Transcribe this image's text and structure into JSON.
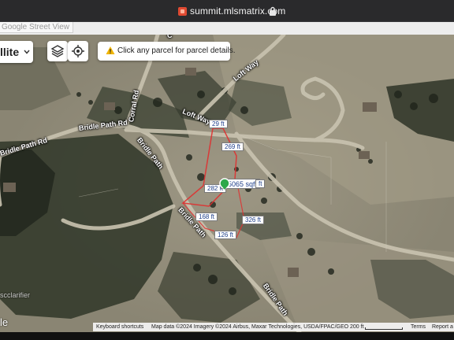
{
  "browser": {
    "url": "summit.mlsmatrix.com",
    "tab_label": "Google Street View"
  },
  "controls": {
    "map_type_label": "llite",
    "layers_icon": "layers-icon",
    "locate_icon": "locate-icon"
  },
  "hint": {
    "text": "Click any parcel for parcel details.",
    "icon": "warning-icon"
  },
  "roads": {
    "bridle_path_rd_1": "Bridle Path Rd",
    "bridle_path_rd_2": "Bridle Path Rd",
    "corral_rd": "Corral Rd",
    "loft_way_1": "Loft Way",
    "loft_way_2": "Loft Way",
    "bridle_path_1": "Bridle Path",
    "bridle_path_2": "Bridle Path",
    "bridle_path_3": "Bridle Path",
    "partial_top": "C"
  },
  "parcel": {
    "area": "95065 sqft",
    "dimensions": {
      "top": "29 ft",
      "upper": "269 ft",
      "left": "282 ft",
      "right": "ft",
      "lower_left": "168 ft",
      "lower_right": "326 ft",
      "bottom": "126 ft"
    },
    "outline_color": "#e03030",
    "label_text_color": "#1f3f8a"
  },
  "footer": {
    "keyboard": "Keyboard shortcuts",
    "map_data": "Map data ©2024 Imagery ©2024 Airbus, Maxar Technologies, USDA/FPAC/GEO",
    "scale": "200 ft",
    "terms": "Terms",
    "report": "Report a"
  },
  "watermarks": {
    "left": "scclarifier",
    "corner": "le"
  }
}
